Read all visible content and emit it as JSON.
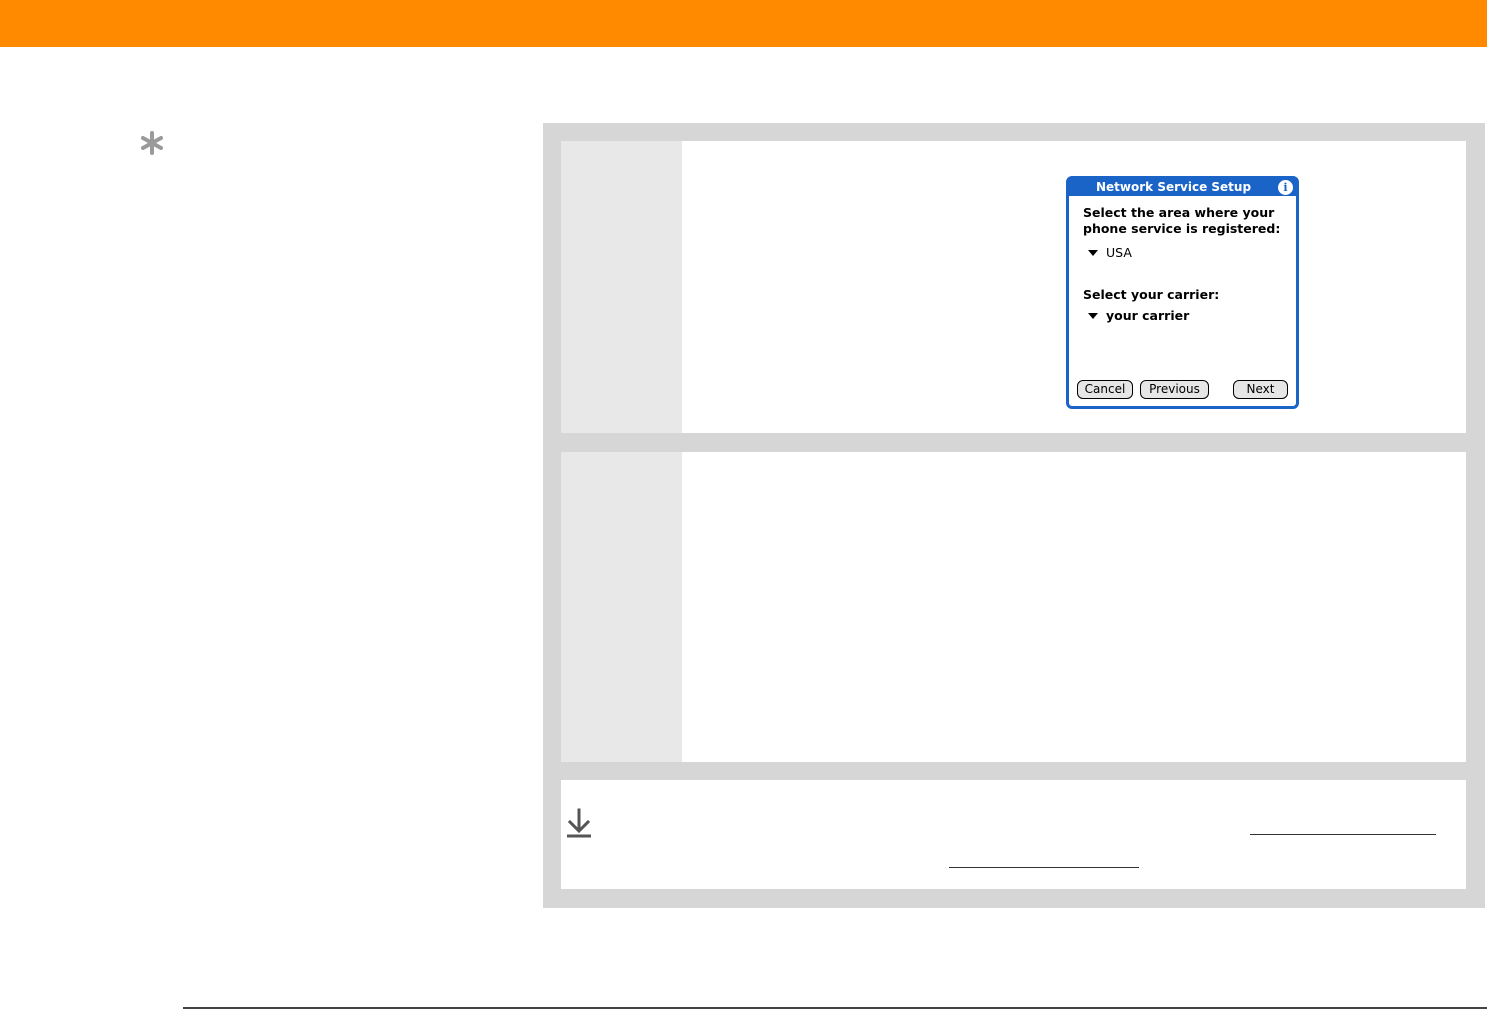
{
  "colors": {
    "header_bar": "#ff8a00",
    "panel_background": "#d6d6d6",
    "step_gutter": "#e8e8e8",
    "dialog_accent": "#1a64c8"
  },
  "icons": {
    "tip": "asterisk-icon",
    "done": "download-arrow-icon",
    "info": "info-icon"
  },
  "dialog": {
    "title": "Network Service Setup",
    "info_glyph": "i",
    "area_prompt": "Select the area where your phone service is registered:",
    "area_value": "USA",
    "carrier_prompt": "Select your carrier:",
    "carrier_value": "your carrier",
    "buttons": {
      "cancel": "Cancel",
      "previous": "Previous",
      "next": "Next"
    }
  }
}
